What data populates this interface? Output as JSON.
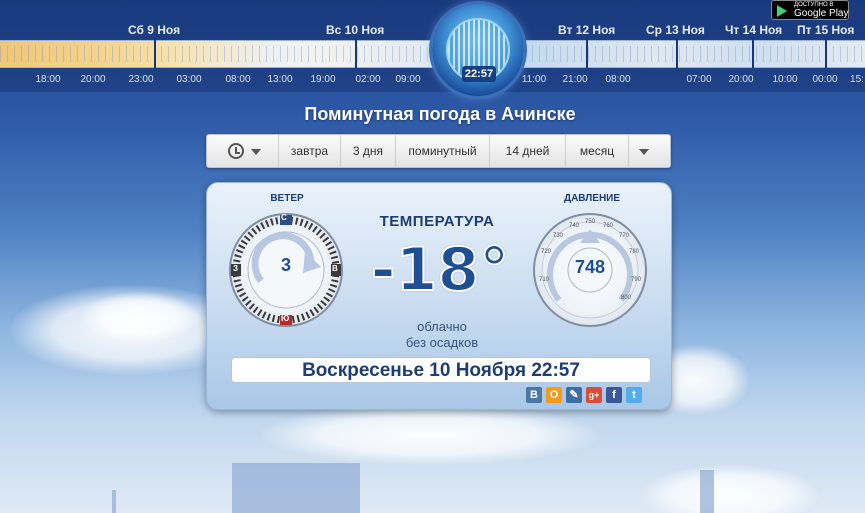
{
  "timeline": {
    "days": [
      {
        "label": "Сб 9 Ноя"
      },
      {
        "label": "Вс 10 Ноя"
      },
      {
        "label": "Вт 12 Ноя"
      },
      {
        "label": "Ср 13 Ноя"
      },
      {
        "label": "Чт 14 Ноя"
      },
      {
        "label": "Пт 15 Ноя"
      }
    ],
    "hours": [
      "18:00",
      "20:00",
      "23:00",
      "03:00",
      "08:00",
      "13:00",
      "19:00",
      "02:00",
      "09:00",
      "11:00",
      "21:00",
      "08:00",
      "07:00",
      "20:00",
      "10:00",
      "00:00",
      "15:"
    ],
    "current_time": "22:57"
  },
  "google_play": {
    "small_text": "ДОСТУПНО В",
    "label": "Google Play"
  },
  "page_title": "Поминутная погода в Ачинске",
  "tabs": {
    "history_icon": "clock-history-icon",
    "items": [
      "завтра",
      "3 дня",
      "поминутный",
      "14 дней",
      "месяц"
    ]
  },
  "wind": {
    "label": "ВЕТЕР",
    "speed": "3",
    "compass": [
      "С",
      "В",
      "Ю",
      "З"
    ]
  },
  "pressure": {
    "label": "ДАВЛЕНИЕ",
    "value": "748",
    "scale": [
      "720",
      "730",
      "740",
      "750",
      "760",
      "770",
      "780",
      "790",
      "800",
      "710"
    ]
  },
  "temperature": {
    "label": "ТЕМПЕРАТУРА",
    "value": "-18°",
    "condition": "облачно",
    "precipitation": "без осадков"
  },
  "datetime": "Воскресенье 10 Ноября 22:57",
  "share": [
    {
      "icon": "vk-icon",
      "glyph": "В",
      "color": "#4a76a8"
    },
    {
      "icon": "odnoklassniki-icon",
      "glyph": "О",
      "color": "#f59a1b"
    },
    {
      "icon": "livejournal-icon",
      "glyph": "✎",
      "color": "#3e6ea5"
    },
    {
      "icon": "google-plus-icon",
      "glyph": "g+",
      "color": "#dd4b39"
    },
    {
      "icon": "facebook-icon",
      "glyph": "f",
      "color": "#3b5998"
    },
    {
      "icon": "twitter-icon",
      "glyph": "t",
      "color": "#55acee"
    }
  ]
}
